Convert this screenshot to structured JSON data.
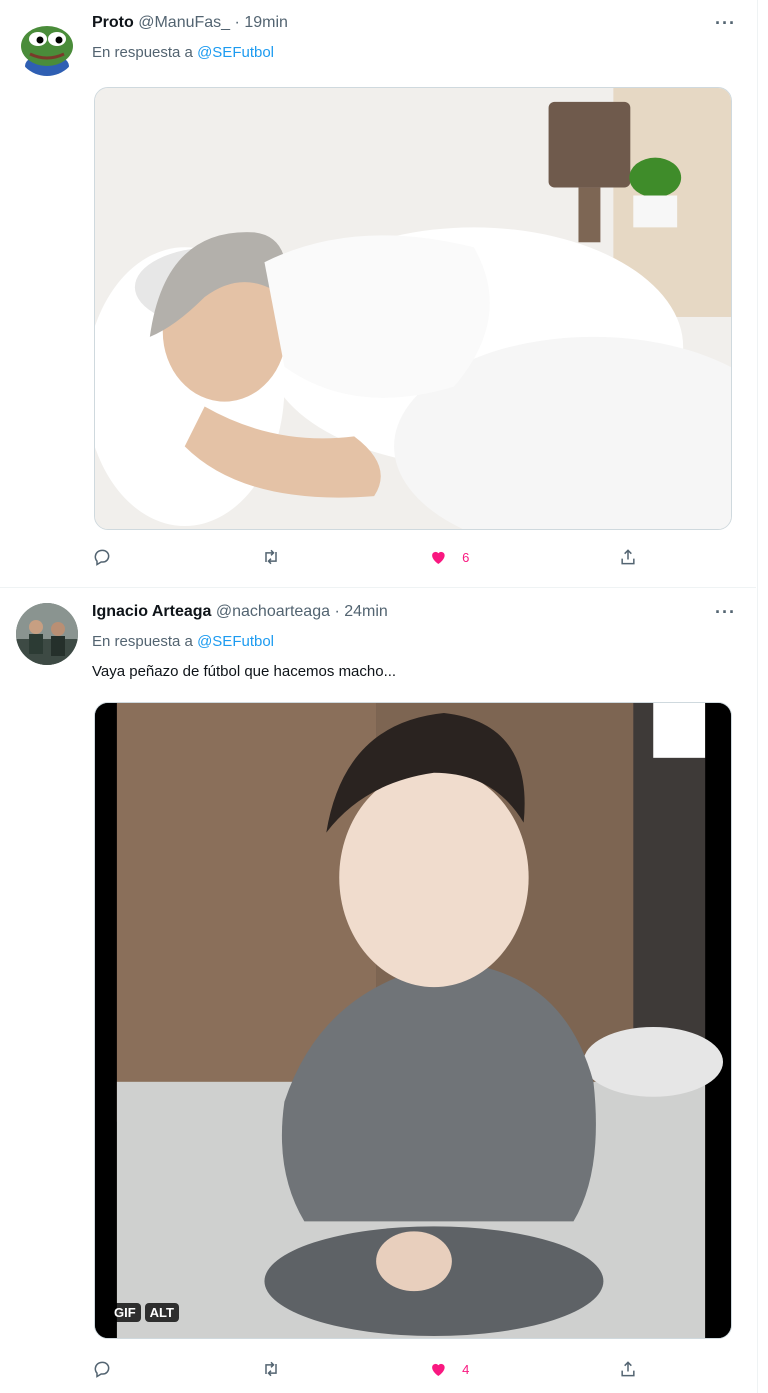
{
  "tweets": [
    {
      "display_name": "Proto",
      "handle": "@ManuFas_",
      "separator": "·",
      "time": "19min",
      "reply_prefix": "En respuesta a",
      "reply_mention": "@SEFutbol",
      "text": "",
      "media_type": "image",
      "actions": {
        "replies": "",
        "retweets": "",
        "likes": "6",
        "liked": true
      }
    },
    {
      "display_name": "Ignacio Arteaga",
      "handle": "@nachoarteaga",
      "separator": "·",
      "time": "24min",
      "reply_prefix": "En respuesta a",
      "reply_mention": "@SEFutbol",
      "text": "Vaya peñazo de fútbol que hacemos macho...",
      "media_type": "gif",
      "media_badges": [
        "GIF",
        "ALT"
      ],
      "actions": {
        "replies": "",
        "retweets": "",
        "likes": "4",
        "liked": true
      }
    }
  ],
  "icons": {
    "more": "more-icon",
    "reply": "reply-icon",
    "retweet": "retweet-icon",
    "like": "heart-icon",
    "share": "share-icon"
  },
  "colors": {
    "accent": "#1d9bf0",
    "like": "#f91880",
    "secondary_text": "#536471",
    "divider": "#eff3f4"
  }
}
